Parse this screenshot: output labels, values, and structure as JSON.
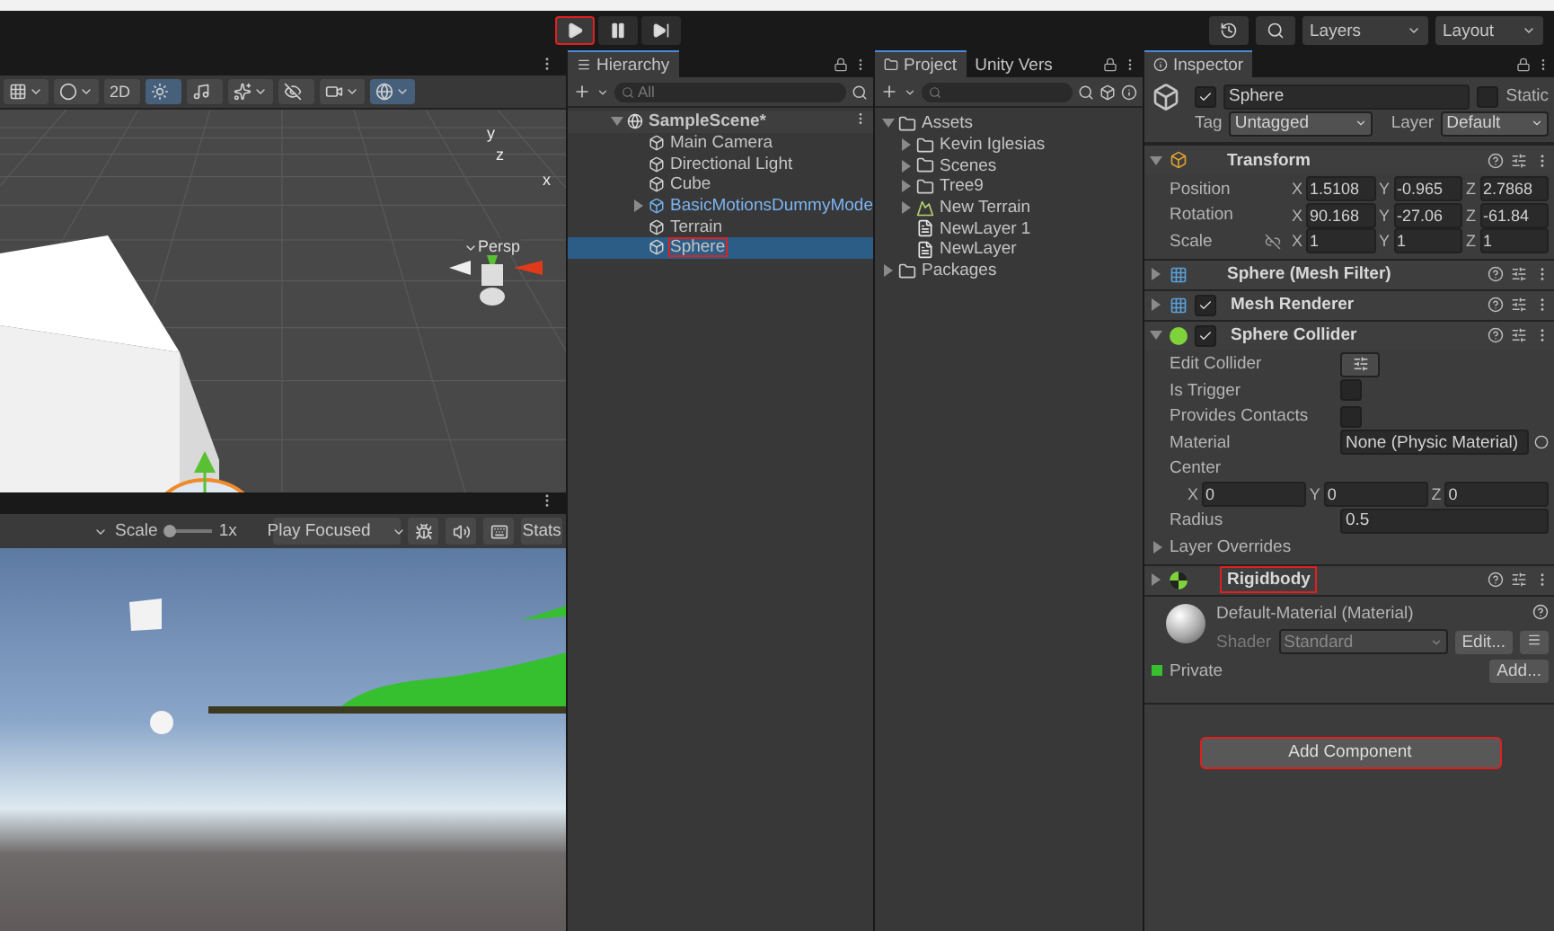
{
  "toolbar": {
    "play_controls": [
      {
        "kind": "play",
        "selected": true,
        "annotated": true
      },
      {
        "kind": "pause",
        "selected": false,
        "annotated": false
      },
      {
        "kind": "step",
        "selected": false,
        "annotated": false
      }
    ],
    "layers": "Layers",
    "layout": "Layout"
  },
  "scene_view": {
    "tools": [
      {
        "kind": "snap",
        "selected": false
      },
      {
        "kind": "shading",
        "selected": false
      },
      {
        "kind": "mode",
        "label": "2D",
        "selected": false
      },
      {
        "kind": "lighting",
        "selected": true
      },
      {
        "kind": "audio",
        "selected": false
      },
      {
        "kind": "effects",
        "selected": false
      },
      {
        "kind": "visibility",
        "selected": false
      },
      {
        "kind": "camera",
        "selected": false
      },
      {
        "kind": "gizmos",
        "selected": true
      }
    ],
    "axis_labels": {
      "y": "y",
      "z": "z",
      "x": "x"
    },
    "projection": "Persp"
  },
  "game_view": {
    "scale_label": "Scale",
    "scale": {
      "level": 0.1
    },
    "scale_value": "1x",
    "play_mode": "Play Focused",
    "stats": "Stats"
  },
  "hierarchy": {
    "title": "Hierarchy",
    "search_placeholder": "All",
    "scene": "SampleScene*",
    "items": [
      {
        "name": "Main Camera",
        "kind": "object",
        "selected": false,
        "annotated": false
      },
      {
        "name": "Directional Light",
        "kind": "object",
        "selected": false,
        "annotated": false
      },
      {
        "name": "Cube",
        "kind": "object",
        "selected": false,
        "annotated": false
      },
      {
        "name": "BasicMotionsDummyMode",
        "kind": "prefab",
        "selected": false,
        "annotated": false
      },
      {
        "name": "Terrain",
        "kind": "object",
        "selected": false,
        "annotated": false
      },
      {
        "name": "Sphere",
        "kind": "object",
        "selected": true,
        "annotated": true
      }
    ]
  },
  "project": {
    "tabs": [
      {
        "label": "Project",
        "selected": true
      },
      {
        "label": "Unity Vers",
        "selected": false
      }
    ],
    "tree": [
      {
        "name": "Assets",
        "kind": "folder",
        "expanded": true,
        "children": [
          {
            "name": "Kevin Iglesias",
            "kind": "folder",
            "expanded": false
          },
          {
            "name": "Scenes",
            "kind": "folder",
            "expanded": false
          },
          {
            "name": "Tree9",
            "kind": "folder",
            "expanded": false
          },
          {
            "name": "New Terrain",
            "kind": "asset",
            "expanded": false
          },
          {
            "name": "NewLayer 1",
            "kind": "file"
          },
          {
            "name": "NewLayer",
            "kind": "file"
          }
        ]
      },
      {
        "name": "Packages",
        "kind": "folder",
        "expanded": false
      }
    ]
  },
  "inspector": {
    "title": "Inspector",
    "object": {
      "active": true,
      "name": "Sphere",
      "static_label": "Static",
      "static": false,
      "tag_label": "Tag",
      "tag": "Untagged",
      "layer_label": "Layer",
      "layer": "Default"
    },
    "components": [
      {
        "kind": "transform",
        "title": "Transform",
        "expanded": true,
        "annotated": false,
        "rows": [
          {
            "label": "Position",
            "fields": [
              {
                "axis": "X",
                "value": "1.5108"
              },
              {
                "axis": "Y",
                "value": "-0.965"
              },
              {
                "axis": "Z",
                "value": "2.7868"
              }
            ]
          },
          {
            "label": "Rotation",
            "fields": [
              {
                "axis": "X",
                "value": "90.168"
              },
              {
                "axis": "Y",
                "value": "-27.06"
              },
              {
                "axis": "Z",
                "value": "-61.84"
              }
            ]
          },
          {
            "label": "Scale",
            "linked": false,
            "fields": [
              {
                "axis": "X",
                "value": "1"
              },
              {
                "axis": "Y",
                "value": "1"
              },
              {
                "axis": "Z",
                "value": "1"
              }
            ]
          }
        ]
      },
      {
        "kind": "mesh_filter",
        "title": "Sphere (Mesh Filter)",
        "expanded": false,
        "annotated": false
      },
      {
        "kind": "mesh_renderer",
        "title": "Mesh Renderer",
        "expanded": false,
        "enabled": true,
        "annotated": false
      },
      {
        "kind": "sphere_collider",
        "title": "Sphere Collider",
        "expanded": true,
        "enabled": true,
        "annotated": false,
        "fields": [
          {
            "kind": "button",
            "label": "Edit Collider"
          },
          {
            "kind": "checkbox",
            "label": "Is Trigger",
            "checked": false
          },
          {
            "kind": "checkbox",
            "label": "Provides Contacts",
            "checked": false
          },
          {
            "kind": "object",
            "label": "Material",
            "value": "None (Physic Material)"
          },
          {
            "kind": "heading",
            "label": "Center"
          },
          {
            "kind": "vector",
            "fields": [
              {
                "axis": "X",
                "value": "0"
              },
              {
                "axis": "Y",
                "value": "0"
              },
              {
                "axis": "Z",
                "value": "0"
              }
            ]
          },
          {
            "kind": "number",
            "label": "Radius",
            "value": "0.5"
          },
          {
            "kind": "foldout",
            "label": "Layer Overrides",
            "expanded": false
          }
        ]
      },
      {
        "kind": "rigidbody",
        "title": "Rigidbody",
        "expanded": false,
        "annotated": true
      }
    ],
    "material": {
      "name": "Default-Material (Material)",
      "shader_label": "Shader",
      "shader": "Standard",
      "edit": "Edit..."
    },
    "private_label": "Private",
    "add_small": "Add...",
    "add_component": "Add Component",
    "add_component_annotated": true
  }
}
